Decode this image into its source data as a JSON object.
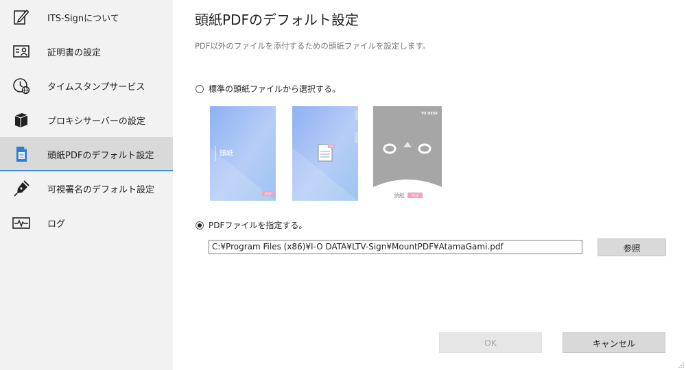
{
  "sidebar": {
    "items": [
      {
        "label": "ITS-Signについて",
        "icon": "document-edit-icon"
      },
      {
        "label": "証明書の設定",
        "icon": "id-card-icon"
      },
      {
        "label": "タイムスタンプサービス",
        "icon": "clock-globe-icon"
      },
      {
        "label": "プロキシサーバーの設定",
        "icon": "server-icon"
      },
      {
        "label": "頭紙PDFのデフォルト設定",
        "icon": "cover-page-icon",
        "active": true
      },
      {
        "label": "可視署名のデフォルト設定",
        "icon": "pen-icon"
      },
      {
        "label": "ログ",
        "icon": "log-monitor-icon"
      }
    ]
  },
  "main": {
    "title": "頭紙PDFのデフォルト設定",
    "subtitle": "PDF以外のファイルを添付するための頭紙ファイルを設定します。",
    "option_standard": {
      "label": "標準の頭紙ファイルから選択する。",
      "selected": false
    },
    "thumbnails": [
      {
        "caption": "頭紙",
        "badge": "PDF"
      },
      {
        "badge": "PDF"
      },
      {
        "caption": "頭紙",
        "badge": "PDF",
        "brand": "TO DESK"
      }
    ],
    "option_custom": {
      "label": "PDFファイルを指定する。",
      "selected": true
    },
    "path_value": "C:¥Program Files (x86)¥I-O DATA¥LTV-Sign¥MountPDF¥AtamaGami.pdf",
    "browse_label": "参照",
    "ok_label": "OK",
    "cancel_label": "キャンセル"
  },
  "colors": {
    "sidebar_bg": "#f2f2f2",
    "active_bg": "#d9d9d9",
    "accent": "#3a8ee6",
    "badge": "#f4a3b8",
    "thumb_blue": "#9db9f3"
  }
}
